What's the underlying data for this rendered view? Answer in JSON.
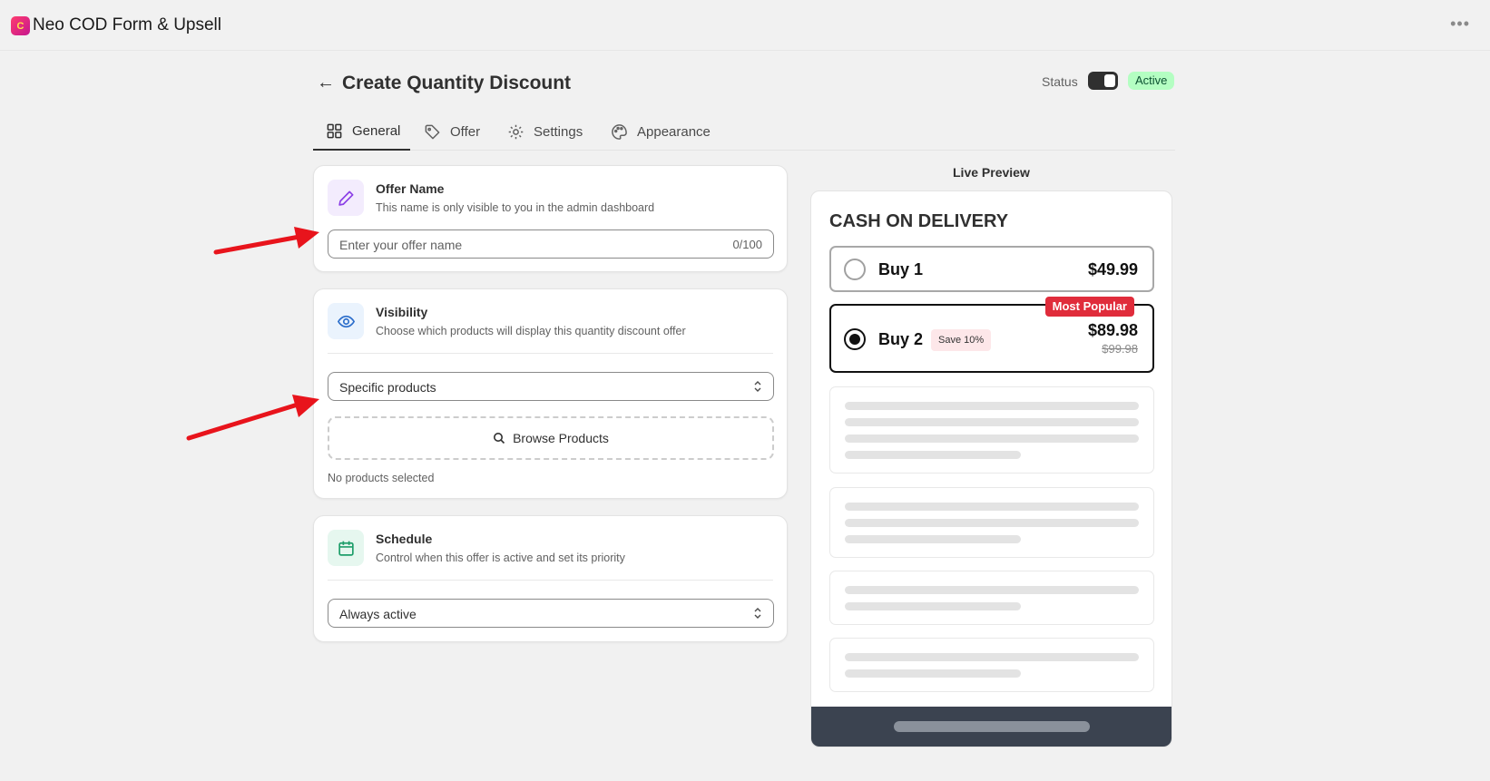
{
  "app": {
    "logo_letter": "C",
    "title": "Neo COD Form & Upsell",
    "more_icon": "ellipsis-icon"
  },
  "header": {
    "back_icon": "arrow-left-icon",
    "title": "Create Quantity Discount",
    "status_label": "Status",
    "status_value": "Active",
    "status_on": true
  },
  "tabs": [
    {
      "label": "General",
      "icon": "grid-icon",
      "active": true
    },
    {
      "label": "Offer",
      "icon": "tag-icon",
      "active": false
    },
    {
      "label": "Settings",
      "icon": "gear-icon",
      "active": false
    },
    {
      "label": "Appearance",
      "icon": "palette-icon",
      "active": false
    }
  ],
  "offer_name": {
    "title": "Offer Name",
    "description": "This name is only visible to you in the admin dashboard",
    "input_value": "",
    "input_placeholder": "Enter your offer name",
    "counter": "0/100",
    "icon": "pencil-icon"
  },
  "visibility": {
    "title": "Visibility",
    "description": "Choose which products will display this quantity discount offer",
    "select_value": "Specific products",
    "browse_label": "Browse Products",
    "note": "No products selected",
    "icon": "eye-icon"
  },
  "schedule": {
    "title": "Schedule",
    "description": "Control when this offer is active and set its priority",
    "select_value": "Always active",
    "icon": "calendar-icon"
  },
  "preview": {
    "title": "Live Preview",
    "heading": "CASH ON DELIVERY",
    "options": [
      {
        "label": "Buy 1",
        "price": "$49.99",
        "selected": false
      },
      {
        "label": "Buy 2",
        "price": "$89.98",
        "old_price": "$99.98",
        "save_tag": "Save 10%",
        "badge": "Most Popular",
        "selected": true
      }
    ]
  },
  "colors": {
    "accent": "#303030",
    "active_badge_bg": "#b4fec2",
    "popular_badge": "#e02c3b",
    "annotation_arrow": "#e8141c"
  }
}
